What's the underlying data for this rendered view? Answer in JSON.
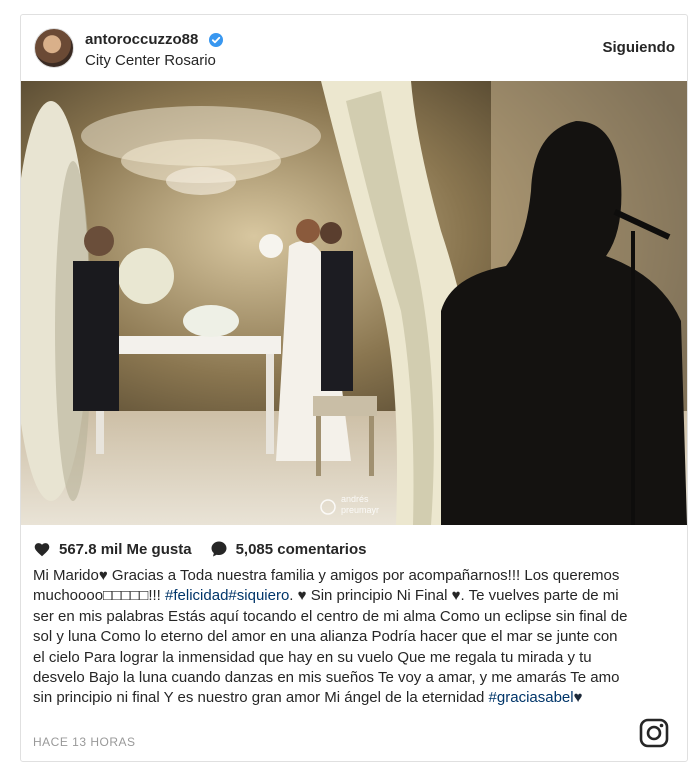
{
  "post": {
    "username": "antoroccuzzo88",
    "location": "City Center Rosario",
    "follow_label": "Siguiendo",
    "likes": "567.8 mil Me gusta",
    "comments": "5,085 comentarios",
    "caption_text": "Mi Marido♥ Gracias a Toda nuestra familia y amigos por acompañarnos!!! Los queremos muchoooo□□□□□!!! ",
    "tag1": "#felicidad",
    "tag2": "#siquiero",
    "caption_mid": ". ♥ Sin principio Ni Final ♥. Te vuelves parte de mi ser en mis palabras Estás aquí tocando el centro de mi alma Como un eclipse sin final de sol y luna Como lo eterno del amor en una alianza Podría hacer que el mar se junte con el cielo Para lograr la inmensidad que hay en su vuelo Que me regala tu mirada y tu desvelo Bajo la luna cuando danzas en mis sueños Te voy a amar, y me amarás Te amo sin principio ni final Y es nuestro gran amor Mi ángel de la eternidad ",
    "tag3": "#graciasabel",
    "caption_end": "♥",
    "time": "HACE 13 HORAS",
    "watermark": "andrés preumayr"
  },
  "icons": {
    "verified": "verified-badge-icon",
    "like": "heart-icon",
    "comment": "comment-icon",
    "logo": "instagram-logo-icon"
  },
  "colors": {
    "text": "#262626",
    "hashtag": "#003569",
    "verified": "#3897f0",
    "muted": "#999999"
  }
}
